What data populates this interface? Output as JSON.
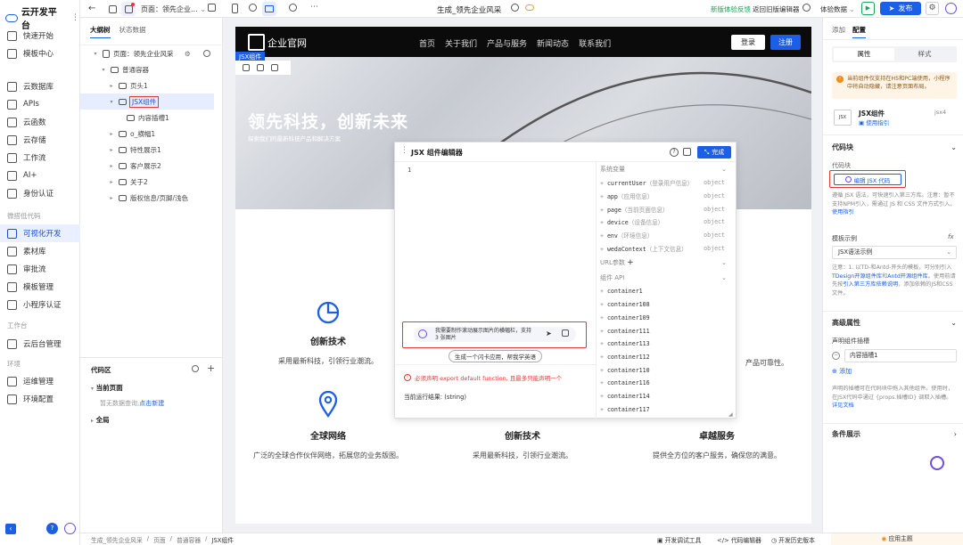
{
  "app": {
    "logo": "云开发平台"
  },
  "sidebar": {
    "items1": [
      {
        "label": "快速开始",
        "icon": "rocket-icon"
      },
      {
        "label": "模板中心",
        "icon": "template-icon"
      }
    ],
    "items2": [
      {
        "label": "云数据库",
        "icon": "database-icon"
      },
      {
        "label": "APIs",
        "icon": "api-icon"
      },
      {
        "label": "云函数",
        "icon": "function-icon"
      },
      {
        "label": "云存储",
        "icon": "storage-icon"
      },
      {
        "label": "工作流",
        "icon": "workflow-icon"
      },
      {
        "label": "AI+",
        "icon": "ai-icon"
      },
      {
        "label": "身份认证",
        "icon": "id-card-icon"
      }
    ],
    "section_lowcode": "微搭低代码",
    "items3": [
      {
        "label": "可视化开发",
        "icon": "visual-dev-icon"
      },
      {
        "label": "素材库",
        "icon": "material-icon"
      },
      {
        "label": "审批流",
        "icon": "approval-icon"
      },
      {
        "label": "模板管理",
        "icon": "template-manage-icon"
      },
      {
        "label": "小程序认证",
        "icon": "miniapp-cert-icon"
      }
    ],
    "section_workbench": "工作台",
    "items4": [
      {
        "label": "云后台管理",
        "icon": "admin-icon"
      }
    ],
    "section_env": "环境",
    "items5": [
      {
        "label": "运维管理",
        "icon": "ops-icon"
      },
      {
        "label": "环境配置",
        "icon": "env-config-icon"
      }
    ]
  },
  "toolbar": {
    "page_select": "页面：领先企业...",
    "page_title": "生成_领先企业风采",
    "feedback": "新版体验反馈",
    "back_old": "返回旧版编辑器",
    "data_select": "体验数据",
    "publish": "发布"
  },
  "outline": {
    "tabs": [
      "大纲树",
      "状态数据"
    ],
    "page_label": "页面：领先企业风采",
    "tree": [
      {
        "label": "普通容器",
        "indent": 1,
        "caret": "▾"
      },
      {
        "label": "页头1",
        "indent": 2,
        "caret": "▸"
      },
      {
        "label": "JSX组件",
        "indent": 2,
        "caret": "▾",
        "selected": true
      },
      {
        "label": "内容插槽1",
        "indent": 3,
        "caret": ""
      },
      {
        "label": "o_横幅1",
        "indent": 2,
        "caret": "▸"
      },
      {
        "label": "特性展示1",
        "indent": 2,
        "caret": "▸"
      },
      {
        "label": "客户展示2",
        "indent": 2,
        "caret": "▸"
      },
      {
        "label": "关于2",
        "indent": 2,
        "caret": "▸"
      },
      {
        "label": "版权信息/页脚/浅色",
        "indent": 2,
        "caret": "▸"
      }
    ]
  },
  "codearea": {
    "title": "代码区",
    "current_page": "当前页面",
    "empty_text": "暂无数据查询,",
    "create_link": "点击新建",
    "global": "全局"
  },
  "canvas": {
    "site_logo": "企业官网",
    "nav": [
      "首页",
      "关于我们",
      "产品与服务",
      "新闻动态",
      "联系我们"
    ],
    "login": "登录",
    "register": "注册",
    "jsx_tag": "JSX组件",
    "hero_title": "领先科技，创新未来",
    "hero_sub": "探索我们的最新科技产品和解决方案",
    "features_top": [
      {
        "title": "创新技术",
        "desc": "采用最新科技，引领行业潮流。"
      }
    ],
    "right_desc_partial": "产品可靠性。",
    "features": [
      {
        "title": "全球网络",
        "desc": "广泛的全球合作伙伴网络，拓展您的业务版图。"
      },
      {
        "title": "创新技术",
        "desc": "采用最新科技，引领行业潮流。"
      },
      {
        "title": "卓越服务",
        "desc": "提供全方位的客户服务，确保您的满意。"
      }
    ]
  },
  "editor": {
    "title": "JSX 组件编辑器",
    "done": "完成",
    "line_no": "1",
    "sys_vars_title": "系统变量",
    "sys_vars": [
      {
        "name": "currentUser",
        "note": "（登录用户信息）",
        "type": "object"
      },
      {
        "name": "app",
        "note": "（应用信息）",
        "type": "object"
      },
      {
        "name": "page",
        "note": "（当前页面信息）",
        "type": "object"
      },
      {
        "name": "device",
        "note": "（设备信息）",
        "type": "object"
      },
      {
        "name": "env",
        "note": "（环境信息）",
        "type": "object"
      },
      {
        "name": "wedaContext",
        "note": "（上下文信息）",
        "type": "object"
      }
    ],
    "url_params": "URL参数",
    "comp_api": "组件 API",
    "containers": [
      "container1",
      "container108",
      "container109",
      "container111",
      "container113",
      "container112",
      "container110",
      "container116",
      "container114",
      "container117"
    ],
    "ai_prompt": "我需要制作滚动展示图片的横幅栏，支持 3 张图片",
    "ai_suggest": "生成一个闪卡应用，帮我学英语",
    "error_text": "必须声明 export default function, 且最多只能声明一个",
    "result": "当前运行结果: (string)"
  },
  "right": {
    "tabs": [
      "添加",
      "配置"
    ],
    "subtabs": [
      "属性",
      "样式"
    ],
    "notice": "当前组件仅支持在H5和PC端使用，小程序中将自动隐藏，请注意页面布局。",
    "comp_name": "JSX组件",
    "comp_version": "jsx4",
    "usage_guide": "使用指引",
    "code_block_title": "代码块",
    "code_block_label": "代码块",
    "edit_btn": "编辑 JSX 代码",
    "code_desc": "遵循 JSX 语法，可快速引入第三方库。注意：暂不支持NPM引入，需通过 JS 和 CSS 文件方式引入。",
    "code_desc_link": "使用指引",
    "template_label": "模板示例",
    "template_value": "JSX语法示例",
    "template_desc": "注意：1. 以TD-和Antd-开头的模板，可分别引入",
    "td_link": "TDesign开源组件库",
    "and": "和",
    "antd_link": "Antd开源组件库",
    "td_desc2": "。使用前请先按",
    "third_link": "引入第三方库依赖说明",
    "td_desc3": "，添加依赖的JS和CSS文件。",
    "adv_title": "高级属性",
    "slot_label": "声明组件插槽",
    "slot_value": "内容插槽1",
    "add": "添加",
    "slot_desc": "声明的插槽可在代码块中拖入其他组件。使用时，在JSX代码中通过 {props.插槽ID} 调取入插槽。",
    "slot_link": "详见文档",
    "cond_title": "条件展示"
  },
  "status": {
    "breadcrumb": [
      "生成_领先企业风采",
      "页面",
      "普通容器",
      "JSX组件"
    ],
    "debug": "开发调试工具",
    "code_editor": "代码编辑器",
    "history": "开发历史版本",
    "theme": "应用主题"
  }
}
